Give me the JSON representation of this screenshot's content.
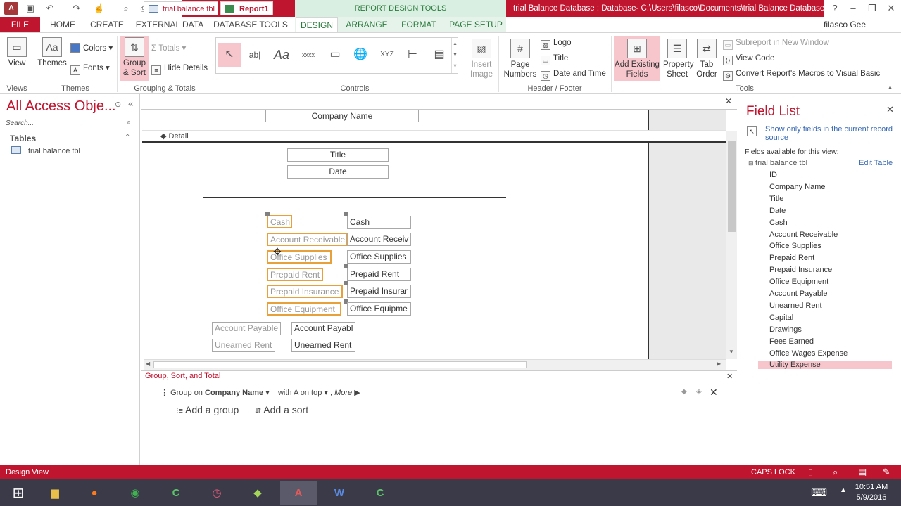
{
  "titlebar": {
    "app_icon": "A",
    "context_tools": "REPORT DESIGN TOOLS",
    "title": "trial Balance Database : Database- C:\\Users\\filasco\\Documents\\trial Balance Database....",
    "help": "?"
  },
  "tabs": {
    "file": "FILE",
    "home": "HOME",
    "create": "CREATE",
    "external": "EXTERNAL DATA",
    "dbtools": "DATABASE TOOLS",
    "design": "DESIGN",
    "arrange": "ARRANGE",
    "format": "FORMAT",
    "pagesetup": "PAGE SETUP",
    "user": "filasco Gee"
  },
  "ribbon": {
    "view": "View",
    "themes": "Themes",
    "colors": "Colors",
    "fonts": "Fonts",
    "group_sort": "Group & Sort",
    "totals": "Totals",
    "hide_details": "Hide Details",
    "insert_image": "Insert Image",
    "page_numbers": "Page Numbers",
    "logo": "Logo",
    "title": "Title",
    "date_time": "Date and Time",
    "add_fields": "Add Existing Fields",
    "property_sheet": "Property Sheet",
    "tab_order": "Tab Order",
    "subreport": "Subreport in New Window",
    "view_code": "View Code",
    "convert_macros": "Convert Report's Macros to Visual Basic",
    "groups": {
      "views": "Views",
      "themes": "Themes",
      "grouping": "Grouping & Totals",
      "controls": "Controls",
      "header_footer": "Header / Footer",
      "tools": "Tools"
    },
    "control_glyphs": {
      "label": "ab|",
      "aa": "Aa",
      "xxxx": "xxxx",
      "xyz": "XYZ"
    }
  },
  "nav": {
    "title": "All Access Obje...",
    "search": "Search...",
    "section": "Tables",
    "item": "trial balance tbl"
  },
  "doctabs": {
    "tab1": "trial balance tbl",
    "tab2": "Report1"
  },
  "report": {
    "company_name": "Company Name",
    "detail": "Detail",
    "title": "Title",
    "date": "Date",
    "labels": [
      "Cash",
      "Account Receivable",
      "Office Supplies",
      "Prepaid Rent",
      "Prepaid Insurance",
      "Office Equipment"
    ],
    "textboxes": [
      "Cash",
      "Account Receiv",
      "Office Supplies",
      "Prepaid Rent",
      "Prepaid Insurar",
      "Office Equipme"
    ],
    "label2": [
      "Account Payable",
      "Unearned Rent"
    ],
    "textboxes2": [
      "Account Payabl",
      "Unearned Rent"
    ]
  },
  "gst": {
    "title": "Group, Sort, and Total",
    "group_on": "Group on",
    "field": "Company Name",
    "with": "with A on top",
    "more": "More",
    "add_group": "Add a group",
    "add_sort": "Add a sort"
  },
  "fieldlist": {
    "title": "Field List",
    "show_only": "Show only fields in the current record source",
    "available": "Fields available for this view:",
    "table": "trial balance tbl",
    "edit": "Edit Table",
    "fields": [
      "ID",
      "Company Name",
      "Title",
      "Date",
      "Cash",
      "Account Receivable",
      "Office Supplies",
      "Prepaid Rent",
      "Prepaid Insurance",
      "Office Equipment",
      "Account Payable",
      "Unearned Rent",
      "Capital",
      "Drawings",
      "Fees Earned",
      "Office Wages Expense",
      "Utility Expense"
    ],
    "highlight_color": "#f6c6cc"
  },
  "status": {
    "mode": "Design View",
    "caps": "CAPS LOCK"
  },
  "taskbar": {
    "time": "10:51 AM",
    "date": "5/9/2016"
  },
  "colors": {
    "accent": "#c0152f",
    "context": "#2a7a3c",
    "selection": "#e8a13a"
  }
}
